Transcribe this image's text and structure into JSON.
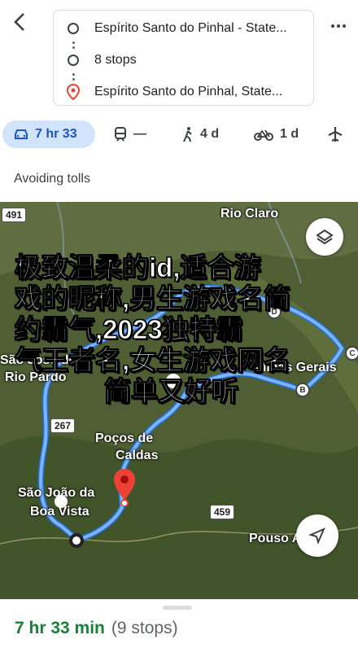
{
  "header": {
    "origin": "Espírito Santo do Pinhal - State...",
    "stops": "8 stops",
    "destination": "Espírito Santo do Pinhal, State..."
  },
  "modes": {
    "drive": "7 hr 33",
    "transit": "—",
    "walk": "4 d",
    "bike": "1 d"
  },
  "notice": "Avoiding tolls",
  "map": {
    "labels": {
      "rio_claro": "Rio Claro",
      "sao_jose": "São José do",
      "rio_pardo": "Rio Pardo",
      "pocos": "Poços de",
      "caldas": "Caldas",
      "sao_joao": "São João da",
      "boa_vista": "Boa Vista",
      "minas": "Minas Gerais",
      "pouso": "Pouso Alegre"
    },
    "shields": {
      "s491": "491",
      "s267": "267",
      "s459": "459"
    },
    "waypoints": {
      "b": "B",
      "c": "C",
      "d": "D"
    }
  },
  "overlay_text": [
    "极致温柔的id,适合游",
    "戏的昵称,男生游戏名简",
    "约霸气,2023独特霸",
    "气王者名,女生游戏网名",
    "简单又好听"
  ],
  "summary": {
    "duration": "7 hr 33 min",
    "stops": "(9 stops)"
  },
  "colors": {
    "accent": "#1a73e8",
    "route": "#7fb3f5",
    "duration": "#188038"
  }
}
